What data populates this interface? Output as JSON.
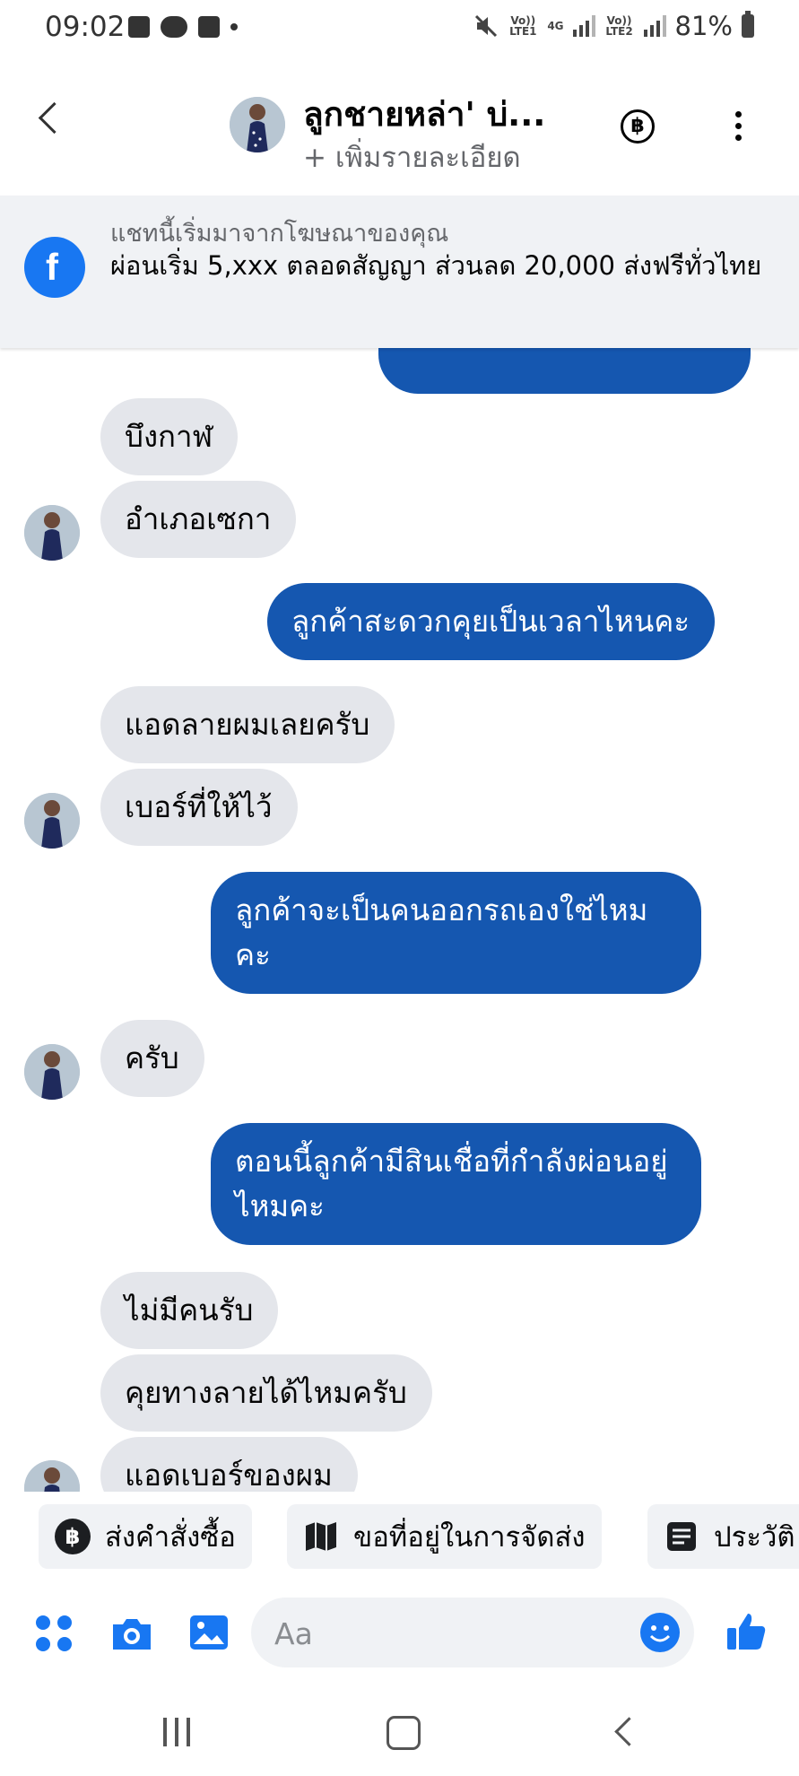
{
  "status_bar": {
    "time": "09:02",
    "network_1": "Vo)) LTE1",
    "network_4g": "4G",
    "network_2": "Vo)) LTE2",
    "battery": "81%"
  },
  "header": {
    "contact_name": "ลูกชายหล่า' บ่...",
    "subtitle": "+ เพิ่มรายละเอียด",
    "baht_symbol": "฿"
  },
  "ad_banner": {
    "title": "แชทนี้เริ่มมาจากโฆษณาของคุณ",
    "body": "ผ่อนเริ่ม 5,xxx ตลอดสัญญา ส่วนลด 20,000 ส่งฟรีทั่วไทย",
    "logo_letter": "f"
  },
  "messages": [
    {
      "sender": "customer",
      "text": "บึงกาฬ"
    },
    {
      "sender": "customer",
      "text": "อำเภอเซกา"
    },
    {
      "sender": "page",
      "text": "ลูกค้าสะดวกคุยเป็นเวลาไหนคะ"
    },
    {
      "sender": "customer",
      "text": "แอดลายผมเลยครับ"
    },
    {
      "sender": "customer",
      "text": "เบอร์ที่ให้ไว้"
    },
    {
      "sender": "page",
      "text": "ลูกค้าจะเป็นคนออกรถเองใช่ไหมคะ"
    },
    {
      "sender": "customer",
      "text": "ครับ"
    },
    {
      "sender": "page",
      "text": "ตอนนี้ลูกค้ามีสินเชื่อที่กำลังผ่อนอยู่ไหมคะ"
    },
    {
      "sender": "customer",
      "text": "ไม่มีคนรับ"
    },
    {
      "sender": "customer",
      "text": "คุยทางลายได้ไหมครับ"
    },
    {
      "sender": "customer",
      "text": "แอดเบอร์ของผม"
    }
  ],
  "quick_replies": [
    {
      "label": "ส่งคำสั่งซื้อ",
      "icon": "baht-circle-icon"
    },
    {
      "label": "ขอที่อยู่ในการจัดส่ง",
      "icon": "map-icon"
    },
    {
      "label": "ประวัติ",
      "icon": "document-icon"
    }
  ],
  "composer": {
    "placeholder": "Aa"
  },
  "colors": {
    "accent": "#1877f2",
    "outgoing_bubble": "#1557b0",
    "incoming_bubble": "#e4e6eb",
    "banner_bg": "#f0f2f5"
  }
}
